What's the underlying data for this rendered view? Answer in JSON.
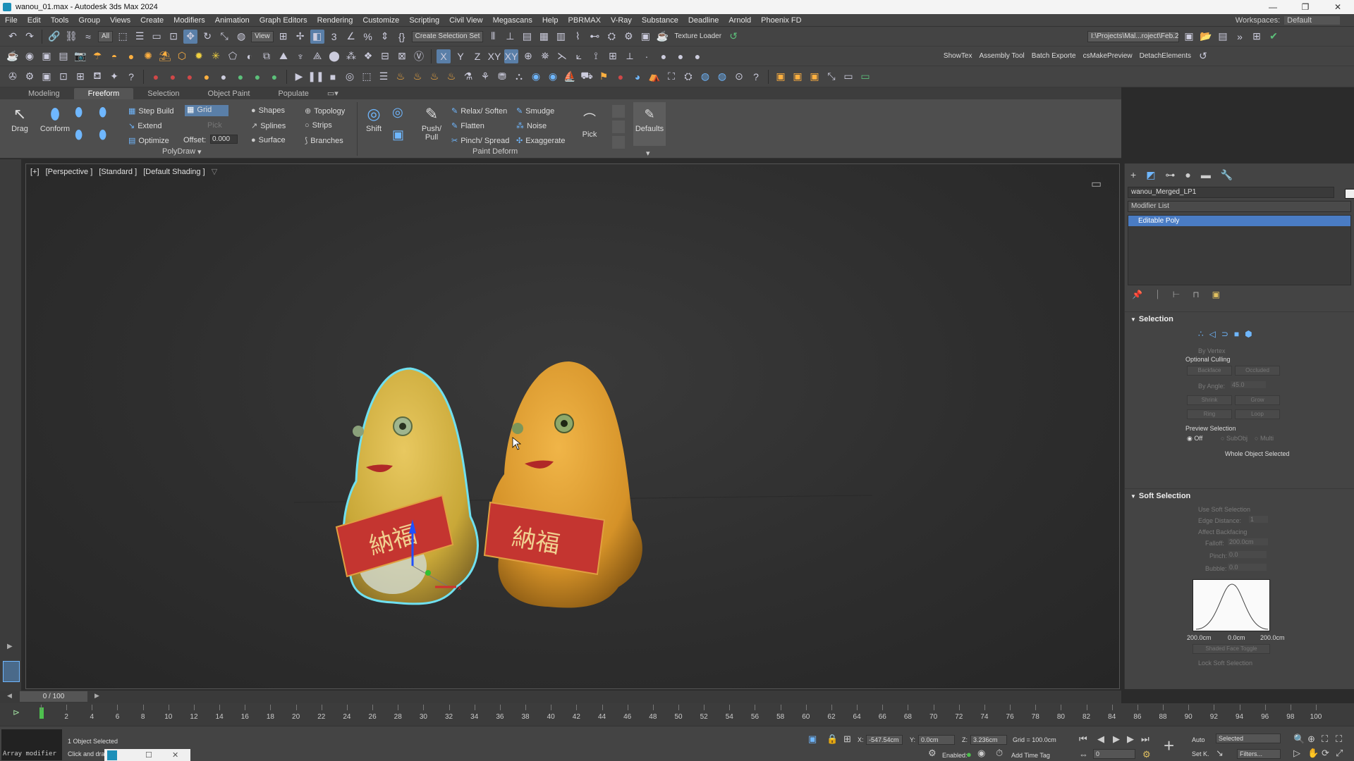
{
  "window": {
    "title": "wanou_01.max - Autodesk 3ds Max 2024",
    "controls": [
      "—",
      "❐",
      "✕"
    ]
  },
  "menu": {
    "items": [
      "File",
      "Edit",
      "Tools",
      "Group",
      "Views",
      "Create",
      "Modifiers",
      "Animation",
      "Graph Editors",
      "Rendering",
      "Customize",
      "Scripting",
      "Civil View",
      "Megascans",
      "Help",
      "PBRMAX",
      "V-Ray",
      "Substance",
      "Deadline",
      "Arnold",
      "Phoenix FD"
    ],
    "workspace_label": "Workspaces:",
    "workspace_value": "Default"
  },
  "toolbar1": {
    "filter_dropdown": "All",
    "view_dropdown": "View",
    "create_selection_set": "Create Selection Set",
    "axis_x": "X",
    "axis_y": "Y",
    "axis_z": "Z",
    "axis_xy": "XY",
    "axis_xy2": "XY",
    "texture_loader": "Texture Loader",
    "project_path": "I:\\Projects\\Mal...roject\\Feb.202"
  },
  "toolbar2": {
    "show_tex": "ShowTex",
    "assembly_tool": "Assembly Tool",
    "batch_exporter": "Batch Exporte",
    "cs_make_preview": "csMakePreview",
    "detach_elements": "DetachElements"
  },
  "ribbon": {
    "tabs": [
      "Modeling",
      "Freeform",
      "Selection",
      "Object Paint",
      "Populate"
    ],
    "drag": "Drag",
    "conform": "Conform",
    "step_build": "Step Build",
    "extend": "Extend",
    "optimize": "Optimize",
    "grid": "Grid",
    "pick": "Pick",
    "offset_label": "Offset:",
    "offset_value": "0.000",
    "shapes": "Shapes",
    "splines": "Splines",
    "surface": "Surface",
    "topology": "Topology",
    "strips": "Strips",
    "branches": "Branches",
    "shift": "Shift",
    "push_pull": "Push/ Pull",
    "relax_soften": "Relax/ Soften",
    "flatten": "Flatten",
    "pinch_spread": "Pinch/ Spread",
    "smudge": "Smudge",
    "noise": "Noise",
    "exaggerate": "Exaggerate",
    "pick_tool": "Pick",
    "defaults": "Defaults",
    "polydraw_label": "PolyDraw",
    "paint_deform_label": "Paint Deform"
  },
  "viewport": {
    "labels": [
      "[+]",
      "[Perspective ]",
      "[Standard ]",
      "[Default Shading ]"
    ],
    "banner_text_left": "納福",
    "banner_text_right": "納福"
  },
  "command_panel": {
    "object_name": "wanou_Merged_LP1",
    "modifier_list": "Modifier List",
    "stack_item": "Editable Poly",
    "selection": {
      "title": "Selection",
      "by_vertex": "By Vertex",
      "optional_culling": "Optional Culling",
      "backface": "Backface",
      "occluded": "Occluded",
      "by_angle": "By Angle:",
      "by_angle_value": "45.0",
      "shrink": "Shrink",
      "grow": "Grow",
      "ring": "Ring",
      "loop": "Loop",
      "preview_selection": "Preview Selection",
      "off": "Off",
      "subobj": "SubObj",
      "multi": "Multi",
      "whole_object": "Whole Object Selected"
    },
    "soft_selection": {
      "title": "Soft Selection",
      "use_soft": "Use Soft Selection",
      "edge_distance": "Edge Distance:",
      "edge_distance_value": "1",
      "affect_backfacing": "Affect Backfacing",
      "falloff": "Falloff:",
      "falloff_value": "200.0cm",
      "pinch": "Pinch:",
      "pinch_value": "0.0",
      "bubble": "Bubble:",
      "bubble_value": "0.0",
      "curve_left": "200.0cm",
      "curve_mid": "0.0cm",
      "curve_right": "200.0cm",
      "shaded_face_toggle": "Shaded Face Toggle",
      "lock_soft": "Lock Soft Selection"
    }
  },
  "timeline": {
    "frame_display": "0 / 100",
    "ticks": [
      "0",
      "2",
      "4",
      "6",
      "8",
      "10",
      "12",
      "14",
      "16",
      "18",
      "20",
      "22",
      "24",
      "26",
      "28",
      "30",
      "32",
      "34",
      "36",
      "38",
      "40",
      "42",
      "44",
      "46",
      "48",
      "50",
      "52",
      "54",
      "56",
      "58",
      "60",
      "62",
      "64",
      "66",
      "68",
      "70",
      "72",
      "74",
      "76",
      "78",
      "80",
      "82",
      "84",
      "86",
      "88",
      "90",
      "92",
      "94",
      "96",
      "98",
      "100"
    ]
  },
  "status": {
    "maxscript": "Array modifier",
    "selected": "1 Object Selected",
    "prompt": "Click and dra",
    "x_label": "X:",
    "x_value": "-547.54cm",
    "y_label": "Y:",
    "y_value": "0.0cm",
    "z_label": "Z:",
    "z_value": "3.236cm",
    "grid": "Grid = 100.0cm",
    "enabled": "Enabled:",
    "add_time_tag": "Add Time Tag",
    "auto": "Auto",
    "set_k": "Set K.",
    "selected_dropdown": "Selected",
    "filters": "Filters...",
    "frame_value": "0"
  }
}
